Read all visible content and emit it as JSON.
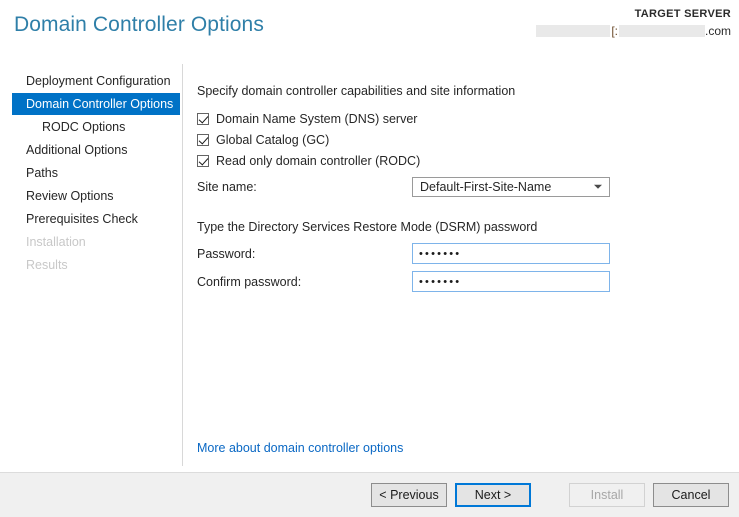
{
  "header": {
    "title": "Domain Controller Options",
    "target_server_label": "TARGET SERVER",
    "target_server_bracket": "[:",
    "target_server_tld": ".com",
    "title_color": "#2f7fa8"
  },
  "sidebar": {
    "items": [
      {
        "label": "Deployment Configuration",
        "state": "normal",
        "indent": false
      },
      {
        "label": "Domain Controller Options",
        "state": "selected",
        "indent": false
      },
      {
        "label": "RODC Options",
        "state": "normal",
        "indent": true
      },
      {
        "label": "Additional Options",
        "state": "normal",
        "indent": false
      },
      {
        "label": "Paths",
        "state": "normal",
        "indent": false
      },
      {
        "label": "Review Options",
        "state": "normal",
        "indent": false
      },
      {
        "label": "Prerequisites Check",
        "state": "normal",
        "indent": false
      },
      {
        "label": "Installation",
        "state": "disabled",
        "indent": false
      },
      {
        "label": "Results",
        "state": "disabled",
        "indent": false
      }
    ],
    "selected_color": "#0072c6"
  },
  "main": {
    "capabilities_heading": "Specify domain controller capabilities and site information",
    "checkboxes": [
      {
        "label": "Domain Name System (DNS) server",
        "checked": true
      },
      {
        "label": "Global Catalog (GC)",
        "checked": true
      },
      {
        "label": "Read only domain controller (RODC)",
        "checked": true
      }
    ],
    "site_name_label": "Site name:",
    "site_name_value": "Default-First-Site-Name",
    "site_name_options": [
      "Default-First-Site-Name"
    ],
    "dsrm_heading": "Type the Directory Services Restore Mode (DSRM) password",
    "password_label": "Password:",
    "password_value": "•••••••",
    "confirm_password_label": "Confirm password:",
    "confirm_password_value": "•••••••",
    "more_link": "More about domain controller options",
    "link_color": "#0a68c4"
  },
  "footer": {
    "previous_label": "< Previous",
    "next_label": "Next >",
    "install_label": "Install",
    "cancel_label": "Cancel",
    "focus_color": "#0078d7"
  }
}
